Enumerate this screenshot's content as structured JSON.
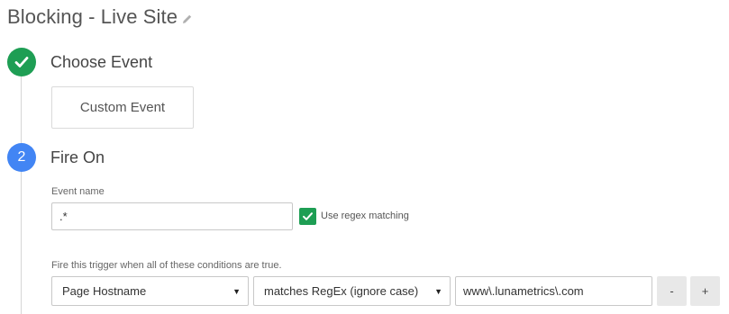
{
  "trigger": {
    "title": "Blocking - Live Site",
    "edit_icon": "pencil-icon"
  },
  "steps": [
    {
      "status": "complete",
      "icon": "checkmark-icon",
      "title": "Choose Event"
    },
    {
      "number": "2",
      "title": "Fire On"
    }
  ],
  "event_type": {
    "label": "Custom Event"
  },
  "fire_on": {
    "event_name_label": "Event name",
    "event_name_value": ".*",
    "regex_checkbox": {
      "checked": true,
      "label": "Use regex matching",
      "icon": "checkmark-icon"
    },
    "conditions_label": "Fire this trigger when all of these conditions are true.",
    "condition": {
      "variable": "Page Hostname",
      "operator": "matches RegEx (ignore case)",
      "value": "www\\.lunametrics\\.com"
    },
    "remove_label": "-",
    "add_label": "+"
  },
  "colors": {
    "success": "#1e9e54",
    "step_active": "#4285f4"
  }
}
